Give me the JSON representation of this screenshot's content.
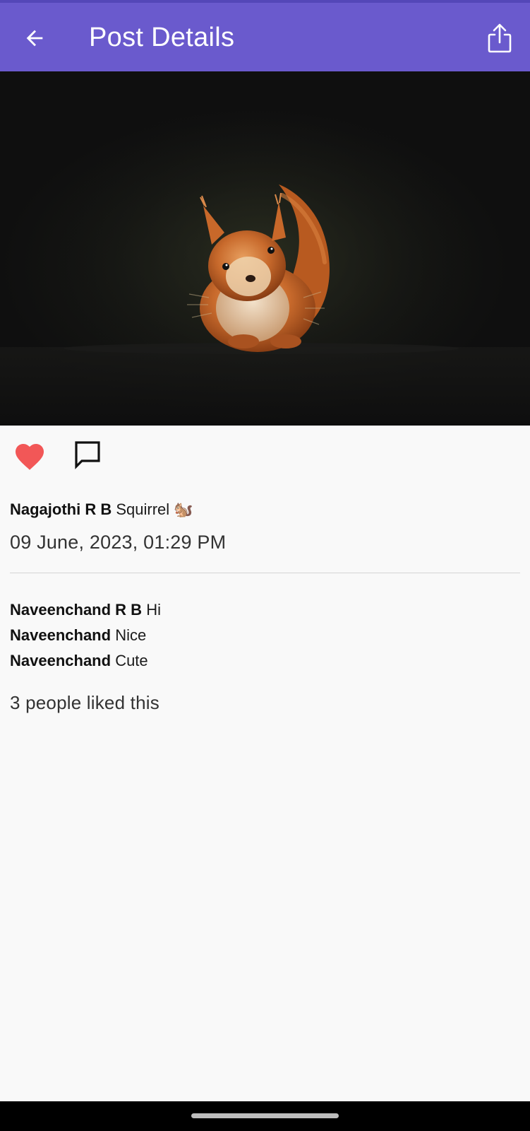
{
  "header": {
    "title": "Post Details",
    "back_icon": "arrow-left-icon",
    "share_icon": "share-icon",
    "color": "#6a5acd"
  },
  "post": {
    "image": "squirrel-photo",
    "author": "Nagajothi R B",
    "caption": "Squirrel 🐿️",
    "timestamp": "09 June, 2023, 01:29 PM",
    "liked": true,
    "like_icon": "heart-icon",
    "comment_icon": "comment-icon",
    "like_color": "#f25757"
  },
  "comments": [
    {
      "author": "Naveenchand R B",
      "text": "Hi"
    },
    {
      "author": "Naveenchand",
      "text": "Nice"
    },
    {
      "author": "Naveenchand",
      "text": "Cute"
    }
  ],
  "likes_summary": "3 people liked this"
}
